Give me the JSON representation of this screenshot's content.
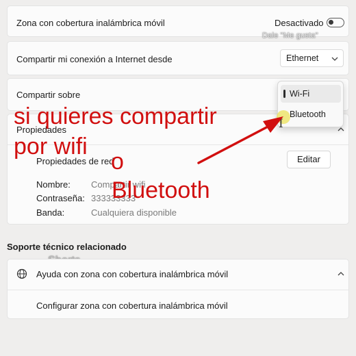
{
  "hotspot": {
    "label": "Zona con cobertura inalámbrica móvil",
    "state": "Desactivado",
    "enabled": false
  },
  "overlay": {
    "like_text": "Dale \"Me gusta\"",
    "shorts_text": "Shorts"
  },
  "share_from": {
    "label": "Compartir mi conexión a Internet desde",
    "selected": "Ethernet"
  },
  "share_over": {
    "label": "Compartir sobre",
    "options": [
      "Wi-Fi",
      "Bluetooth"
    ],
    "selected": "Wi-Fi"
  },
  "properties": {
    "header": "Propiedades",
    "network_props_label": "Propiedades de red",
    "edit_button": "Editar",
    "fields": [
      {
        "key": "Nombre:",
        "value": "Compartir wifi"
      },
      {
        "key": "Contraseña:",
        "value": "333333333"
      },
      {
        "key": "Banda:",
        "value": "Cualquiera disponible"
      }
    ]
  },
  "support": {
    "title": "Soporte técnico relacionado",
    "help_item": "Ayuda con zona con cobertura inalámbrica móvil",
    "link": "Configurar zona con cobertura inalámbrica móvil"
  },
  "annotation": {
    "line1": "si quieres compartir",
    "line2": "por wifi",
    "line3": "o",
    "line4": "Bluetooth",
    "color": "#d10f0f"
  }
}
